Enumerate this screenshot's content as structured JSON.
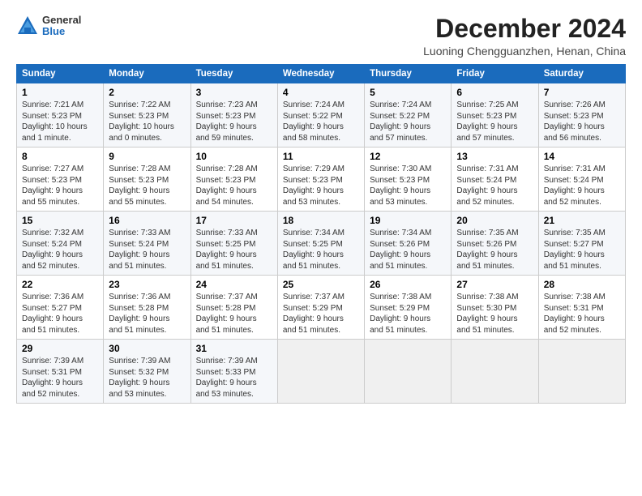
{
  "logo": {
    "general": "General",
    "blue": "Blue"
  },
  "title": "December 2024",
  "subtitle": "Luoning Chengguanzhen, Henan, China",
  "days_header": [
    "Sunday",
    "Monday",
    "Tuesday",
    "Wednesday",
    "Thursday",
    "Friday",
    "Saturday"
  ],
  "weeks": [
    [
      {
        "day": "1",
        "lines": [
          "Sunrise: 7:21 AM",
          "Sunset: 5:23 PM",
          "Daylight: 10 hours",
          "and 1 minute."
        ]
      },
      {
        "day": "2",
        "lines": [
          "Sunrise: 7:22 AM",
          "Sunset: 5:23 PM",
          "Daylight: 10 hours",
          "and 0 minutes."
        ]
      },
      {
        "day": "3",
        "lines": [
          "Sunrise: 7:23 AM",
          "Sunset: 5:23 PM",
          "Daylight: 9 hours",
          "and 59 minutes."
        ]
      },
      {
        "day": "4",
        "lines": [
          "Sunrise: 7:24 AM",
          "Sunset: 5:22 PM",
          "Daylight: 9 hours",
          "and 58 minutes."
        ]
      },
      {
        "day": "5",
        "lines": [
          "Sunrise: 7:24 AM",
          "Sunset: 5:22 PM",
          "Daylight: 9 hours",
          "and 57 minutes."
        ]
      },
      {
        "day": "6",
        "lines": [
          "Sunrise: 7:25 AM",
          "Sunset: 5:23 PM",
          "Daylight: 9 hours",
          "and 57 minutes."
        ]
      },
      {
        "day": "7",
        "lines": [
          "Sunrise: 7:26 AM",
          "Sunset: 5:23 PM",
          "Daylight: 9 hours",
          "and 56 minutes."
        ]
      }
    ],
    [
      {
        "day": "8",
        "lines": [
          "Sunrise: 7:27 AM",
          "Sunset: 5:23 PM",
          "Daylight: 9 hours",
          "and 55 minutes."
        ]
      },
      {
        "day": "9",
        "lines": [
          "Sunrise: 7:28 AM",
          "Sunset: 5:23 PM",
          "Daylight: 9 hours",
          "and 55 minutes."
        ]
      },
      {
        "day": "10",
        "lines": [
          "Sunrise: 7:28 AM",
          "Sunset: 5:23 PM",
          "Daylight: 9 hours",
          "and 54 minutes."
        ]
      },
      {
        "day": "11",
        "lines": [
          "Sunrise: 7:29 AM",
          "Sunset: 5:23 PM",
          "Daylight: 9 hours",
          "and 53 minutes."
        ]
      },
      {
        "day": "12",
        "lines": [
          "Sunrise: 7:30 AM",
          "Sunset: 5:23 PM",
          "Daylight: 9 hours",
          "and 53 minutes."
        ]
      },
      {
        "day": "13",
        "lines": [
          "Sunrise: 7:31 AM",
          "Sunset: 5:24 PM",
          "Daylight: 9 hours",
          "and 52 minutes."
        ]
      },
      {
        "day": "14",
        "lines": [
          "Sunrise: 7:31 AM",
          "Sunset: 5:24 PM",
          "Daylight: 9 hours",
          "and 52 minutes."
        ]
      }
    ],
    [
      {
        "day": "15",
        "lines": [
          "Sunrise: 7:32 AM",
          "Sunset: 5:24 PM",
          "Daylight: 9 hours",
          "and 52 minutes."
        ]
      },
      {
        "day": "16",
        "lines": [
          "Sunrise: 7:33 AM",
          "Sunset: 5:24 PM",
          "Daylight: 9 hours",
          "and 51 minutes."
        ]
      },
      {
        "day": "17",
        "lines": [
          "Sunrise: 7:33 AM",
          "Sunset: 5:25 PM",
          "Daylight: 9 hours",
          "and 51 minutes."
        ]
      },
      {
        "day": "18",
        "lines": [
          "Sunrise: 7:34 AM",
          "Sunset: 5:25 PM",
          "Daylight: 9 hours",
          "and 51 minutes."
        ]
      },
      {
        "day": "19",
        "lines": [
          "Sunrise: 7:34 AM",
          "Sunset: 5:26 PM",
          "Daylight: 9 hours",
          "and 51 minutes."
        ]
      },
      {
        "day": "20",
        "lines": [
          "Sunrise: 7:35 AM",
          "Sunset: 5:26 PM",
          "Daylight: 9 hours",
          "and 51 minutes."
        ]
      },
      {
        "day": "21",
        "lines": [
          "Sunrise: 7:35 AM",
          "Sunset: 5:27 PM",
          "Daylight: 9 hours",
          "and 51 minutes."
        ]
      }
    ],
    [
      {
        "day": "22",
        "lines": [
          "Sunrise: 7:36 AM",
          "Sunset: 5:27 PM",
          "Daylight: 9 hours",
          "and 51 minutes."
        ]
      },
      {
        "day": "23",
        "lines": [
          "Sunrise: 7:36 AM",
          "Sunset: 5:28 PM",
          "Daylight: 9 hours",
          "and 51 minutes."
        ]
      },
      {
        "day": "24",
        "lines": [
          "Sunrise: 7:37 AM",
          "Sunset: 5:28 PM",
          "Daylight: 9 hours",
          "and 51 minutes."
        ]
      },
      {
        "day": "25",
        "lines": [
          "Sunrise: 7:37 AM",
          "Sunset: 5:29 PM",
          "Daylight: 9 hours",
          "and 51 minutes."
        ]
      },
      {
        "day": "26",
        "lines": [
          "Sunrise: 7:38 AM",
          "Sunset: 5:29 PM",
          "Daylight: 9 hours",
          "and 51 minutes."
        ]
      },
      {
        "day": "27",
        "lines": [
          "Sunrise: 7:38 AM",
          "Sunset: 5:30 PM",
          "Daylight: 9 hours",
          "and 51 minutes."
        ]
      },
      {
        "day": "28",
        "lines": [
          "Sunrise: 7:38 AM",
          "Sunset: 5:31 PM",
          "Daylight: 9 hours",
          "and 52 minutes."
        ]
      }
    ],
    [
      {
        "day": "29",
        "lines": [
          "Sunrise: 7:39 AM",
          "Sunset: 5:31 PM",
          "Daylight: 9 hours",
          "and 52 minutes."
        ]
      },
      {
        "day": "30",
        "lines": [
          "Sunrise: 7:39 AM",
          "Sunset: 5:32 PM",
          "Daylight: 9 hours",
          "and 53 minutes."
        ]
      },
      {
        "day": "31",
        "lines": [
          "Sunrise: 7:39 AM",
          "Sunset: 5:33 PM",
          "Daylight: 9 hours",
          "and 53 minutes."
        ]
      },
      null,
      null,
      null,
      null
    ]
  ]
}
